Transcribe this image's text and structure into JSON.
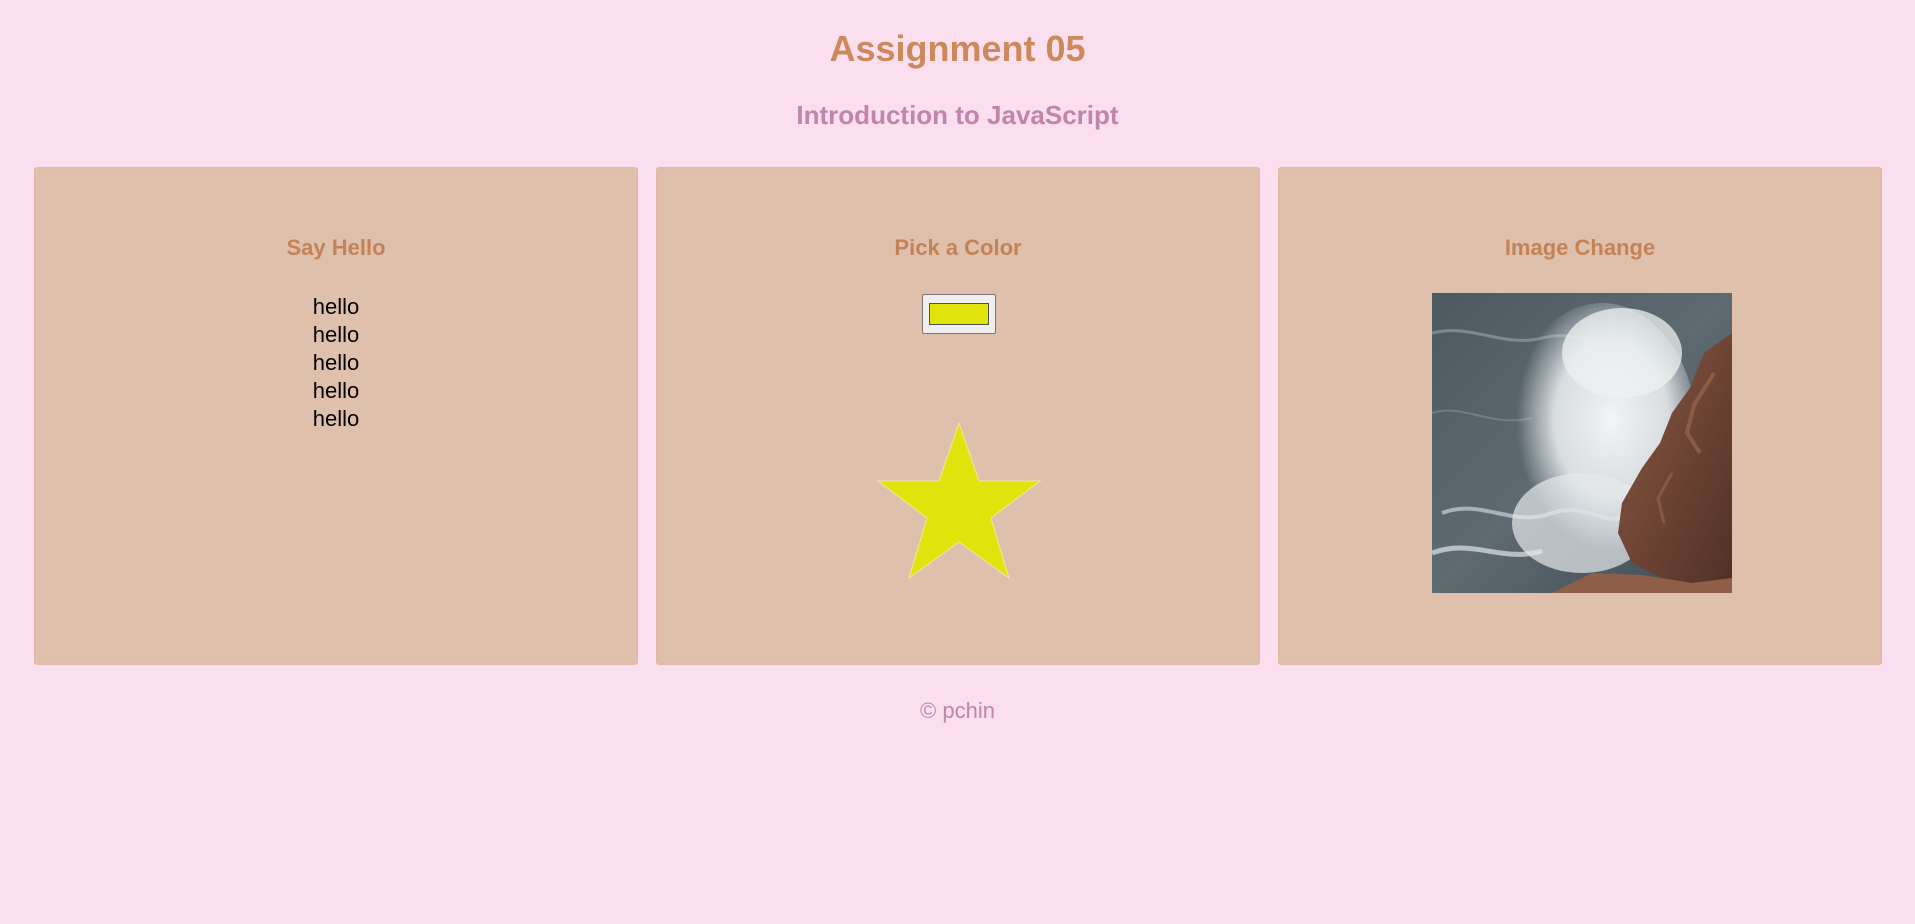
{
  "header": {
    "title": "Assignment 05",
    "subtitle": "Introduction to JavaScript"
  },
  "panels": {
    "hello": {
      "heading": "Say Hello",
      "items": [
        "hello",
        "hello",
        "hello",
        "hello",
        "hello"
      ]
    },
    "color": {
      "heading": "Pick a Color",
      "selected_color": "#e0e40c",
      "shape_icon": "star-icon"
    },
    "image": {
      "heading": "Image Change",
      "image_subject": "ocean waves crashing on rocks"
    }
  },
  "footer": {
    "text": "© pchin"
  },
  "colors": {
    "background": "#fbdfef",
    "panel": "#dfc0ad",
    "title": "#cc8a5c",
    "subtitle": "#c084ad",
    "star": "#e0e40c"
  }
}
